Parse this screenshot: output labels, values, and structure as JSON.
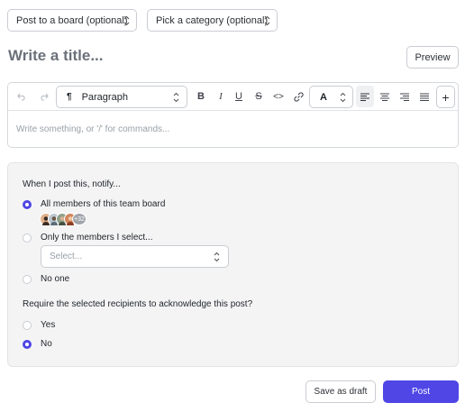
{
  "header": {
    "board_select": "Post to a board (optional)",
    "category_select": "Pick a category (optional)"
  },
  "title": {
    "placeholder": "Write a title...",
    "preview_label": "Preview"
  },
  "toolbar": {
    "paragraph_style": "Paragraph",
    "paragraph_icon": "¶",
    "bold": "B",
    "italic": "I",
    "underline": "U",
    "strike": "S",
    "code": "<>",
    "text_color": "A",
    "add": "+",
    "icons": [
      "undo-icon",
      "redo-icon",
      "link-icon",
      "align-left-icon",
      "align-center-icon",
      "align-right-icon",
      "align-justify-icon"
    ]
  },
  "editor": {
    "placeholder": "Write something, or '/' for commands..."
  },
  "notify": {
    "heading": "When I post this, notify...",
    "options": [
      {
        "label": "All members of this team board",
        "checked": true
      },
      {
        "label": "Only the members I select...",
        "checked": false
      },
      {
        "label": "No one",
        "checked": false
      }
    ],
    "avatar_overflow": "+32",
    "member_select_placeholder": "Select..."
  },
  "acknowledge": {
    "heading": "Require the selected recipients to acknowledge this post?",
    "options": [
      {
        "label": "Yes",
        "checked": false
      },
      {
        "label": "No",
        "checked": true
      }
    ]
  },
  "footer": {
    "draft_label": "Save as draft",
    "post_label": "Post"
  },
  "colors": {
    "accent": "#4f46e5",
    "panel_bg": "#f4f4f5",
    "placeholder": "#9aa0a7"
  }
}
